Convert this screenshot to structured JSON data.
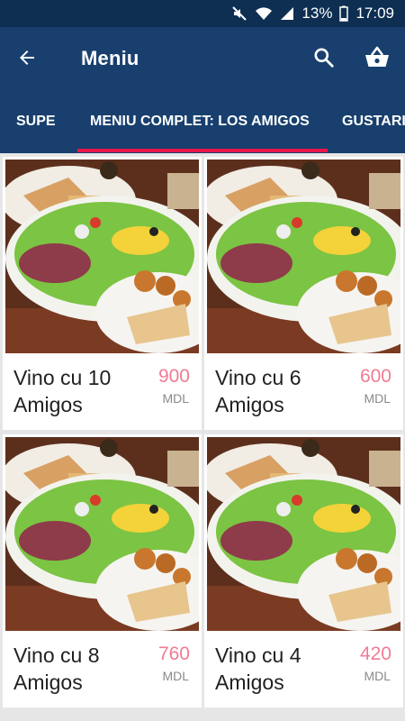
{
  "status_bar": {
    "battery": "13%",
    "time": "17:09"
  },
  "app_bar": {
    "title": "Meniu"
  },
  "tabs": [
    {
      "label": "SUPE",
      "selected": false
    },
    {
      "label": "MENIU COMPLET: LOS AMIGOS",
      "selected": true
    },
    {
      "label": "GUSTARI",
      "selected": false
    }
  ],
  "colors": {
    "primary": "#183f6e",
    "status_bar": "#0e2f52",
    "tab_indicator": "#e8174a",
    "price": "#f07c93"
  },
  "menu_items": [
    {
      "name": "Vino cu 10 Amigos",
      "price": "900",
      "currency": "MDL"
    },
    {
      "name": "Vino cu 6 Amigos",
      "price": "600",
      "currency": "MDL"
    },
    {
      "name": "Vino cu 8 Amigos",
      "price": "760",
      "currency": "MDL"
    },
    {
      "name": "Vino cu 4 Amigos",
      "price": "420",
      "currency": "MDL"
    }
  ]
}
